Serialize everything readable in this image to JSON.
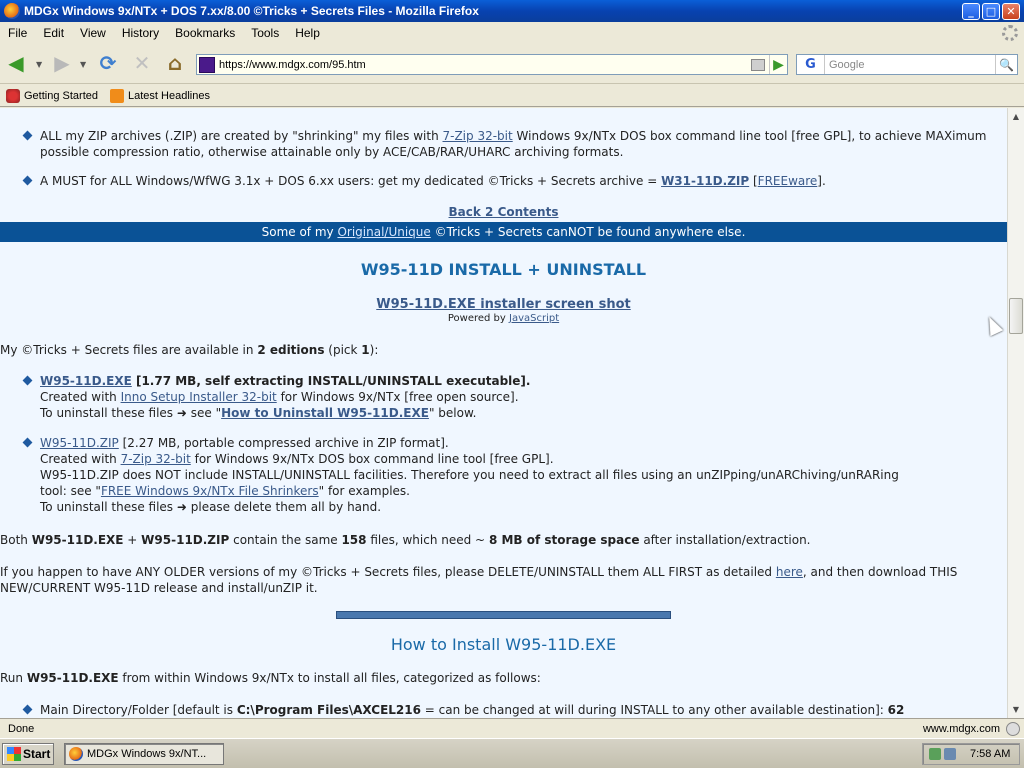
{
  "window": {
    "title": "MDGx Windows 9x/NTx + DOS 7.xx/8.00 ©Tricks + Secrets Files - Mozilla Firefox",
    "min": "_",
    "max": "□",
    "close": "✕"
  },
  "menu": [
    "File",
    "Edit",
    "View",
    "History",
    "Bookmarks",
    "Tools",
    "Help"
  ],
  "nav": {
    "url": "https://www.mdgx.com/95.htm",
    "search_placeholder": "Google",
    "search_engine": "G"
  },
  "bookmarks": [
    "Getting Started",
    "Latest Headlines"
  ],
  "page": {
    "bullet1_a": "ALL my ZIP archives (.ZIP) are created by \"shrinking\" my files with ",
    "bullet1_link": "7-Zip 32-bit",
    "bullet1_b": " Windows 9x/NTx DOS box command line tool [free GPL], to achieve MAXimum possible compression ratio, otherwise attainable only by ACE/CAB/RAR/UHARC archiving formats.",
    "bullet2_a": "A MUST for ALL Windows/WfWG 3.1x + DOS 6.xx users: get my dedicated ©Tricks + Secrets archive = ",
    "bullet2_link": "W31-11D.ZIP",
    "bullet2_b": " [",
    "bullet2_link2": "FREEware",
    "bullet2_c": "].",
    "back_link": "Back 2 Contents",
    "banner_a": "Some of my ",
    "banner_link": "Original/Unique",
    "banner_b": " ©Tricks + Secrets canNOT be found anywhere else.",
    "heading": "W95-11D INSTALL + UNINSTALL",
    "screenshot_link": "W95-11D.EXE installer screen shot",
    "powered_a": "Powered by ",
    "powered_link": "JavaScript",
    "editions_a": "My ©Tricks + Secrets files are available in ",
    "editions_b": "2 editions",
    "editions_c": " (pick ",
    "editions_d": "1",
    "editions_e": "):",
    "exe_link": "W95-11D.EXE",
    "exe_desc": " [1.77 MB, self extracting INSTALL/UNINSTALL executable].",
    "exe_l2a": "Created with ",
    "exe_l2link": "Inno Setup Installer 32-bit",
    "exe_l2b": " for Windows 9x/NTx [free open source].",
    "exe_l3a": "To uninstall these files ➜ see \"",
    "exe_l3link": "How to Uninstall W95-11D.EXE",
    "exe_l3b": "\" below.",
    "zip_link": "W95-11D.ZIP",
    "zip_desc": " [2.27 MB, portable compressed archive in ZIP format].",
    "zip_l2a": "Created with ",
    "zip_l2link": "7-Zip 32-bit",
    "zip_l2b": " for Windows 9x/NTx DOS box command line tool [free GPL].",
    "zip_l3": "W95-11D.ZIP does NOT include INSTALL/UNINSTALL facilities. Therefore you need to extract all files using an unZIPping/unARChiving/unRARing",
    "zip_l4a": "tool: see \"",
    "zip_l4link": "FREE Windows 9x/NTx File Shrinkers",
    "zip_l4b": "\" for examples.",
    "zip_l5": "To uninstall these files ➜ please delete them all by hand.",
    "both_a": "Both ",
    "both_b": "W95-11D.EXE",
    "both_c": " + ",
    "both_d": "W95-11D.ZIP",
    "both_e": " contain the same ",
    "both_f": "158",
    "both_g": " files, which need ~ ",
    "both_h": "8 MB of storage space",
    "both_i": " after installation/extraction.",
    "older_a": "If you happen to have ANY OLDER versions of my ©Tricks + Secrets files, please DELETE/UNINSTALL them ALL FIRST as detailed ",
    "older_link": "here",
    "older_b": ", and then download THIS NEW/CURRENT W95-11D release and install/unZIP it.",
    "how_heading": "How to Install W95-11D.EXE",
    "run_a": "Run ",
    "run_b": "W95-11D.EXE",
    "run_c": " from within Windows 9x/NTx to install all files, categorized as follows:",
    "main_a": "Main Directory/Folder [default is ",
    "main_b": "C:\\Program Files\\AXCEL216",
    "main_c": " = can be changed at will during INSTALL to any other available destination]: ",
    "main_d": "62"
  },
  "status": {
    "text": "Done",
    "domain": "www.mdgx.com"
  },
  "taskbar": {
    "start": "Start",
    "task": "MDGx Windows 9x/NT...",
    "clock": "7:58 AM"
  }
}
